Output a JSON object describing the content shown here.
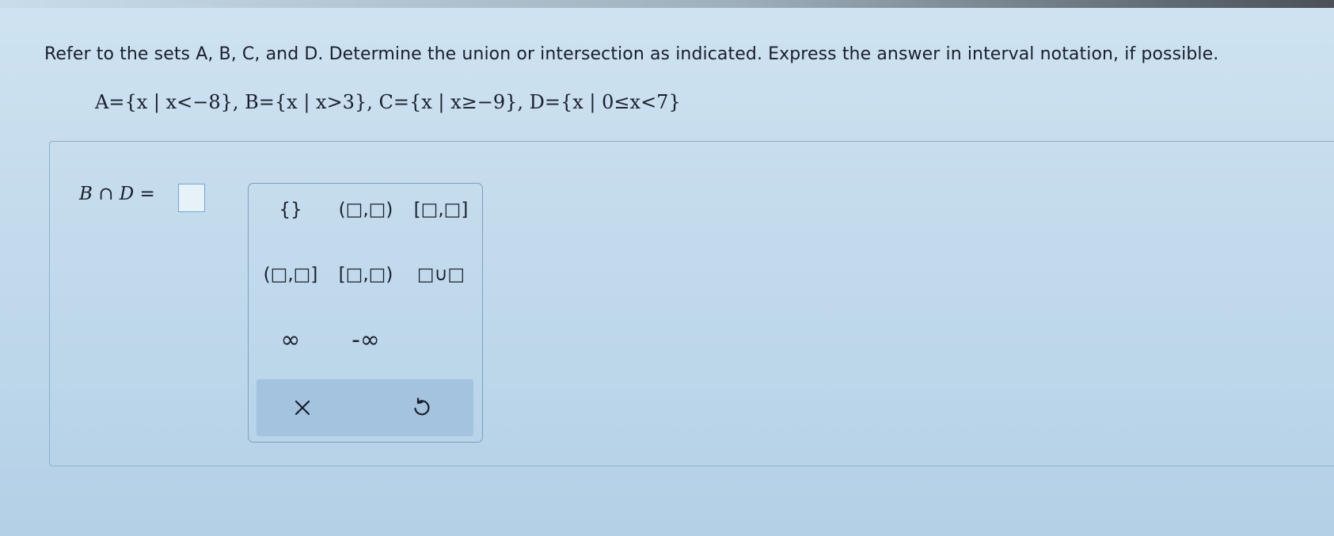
{
  "problem": {
    "instructions": "Refer to the sets A, B, C, and D. Determine the union or intersection as indicated. Express the answer in interval notation, if possible.",
    "sets_definition": "A={x | x<−8}, B={x | x>3}, C={x | x≥−9}, D={x | 0≤x<7}"
  },
  "question": {
    "expression": "B ∩ D ="
  },
  "palette": {
    "buttons": [
      {
        "label": "{}"
      },
      {
        "label": "(□,□)"
      },
      {
        "label": "[□,□]"
      },
      {
        "label": "(□,□]"
      },
      {
        "label": "[□,□)"
      },
      {
        "label": "□∪□"
      },
      {
        "label": "∞"
      },
      {
        "label": "-∞"
      }
    ],
    "clear_icon": "close-icon",
    "undo_icon": "undo-icon"
  }
}
